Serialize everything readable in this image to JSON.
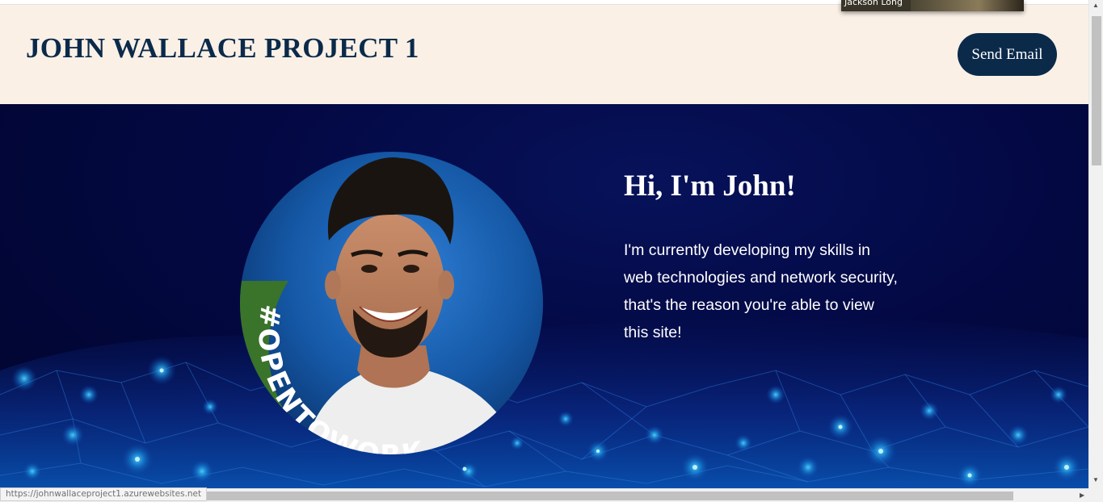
{
  "header": {
    "title": "JOHN WALLACE PROJECT 1",
    "send_email_label": "Send Email"
  },
  "hero": {
    "heading": "Hi, I'm John!",
    "body": "I'm currently developing my skills in web technologies and network security, that's the reason you're able to view this site!",
    "profile_badge_text": "#OPENTOWORK"
  },
  "video_overlay": {
    "participant_name": "Jackson Long"
  },
  "status_bar": {
    "url": "https://johnwallaceproject1.azurewebsites.net"
  },
  "colors": {
    "header_bg": "#faf0e6",
    "brand_navy": "#0b2a4a",
    "hero_bg": "#030842",
    "badge_green": "#3f7a2e"
  }
}
